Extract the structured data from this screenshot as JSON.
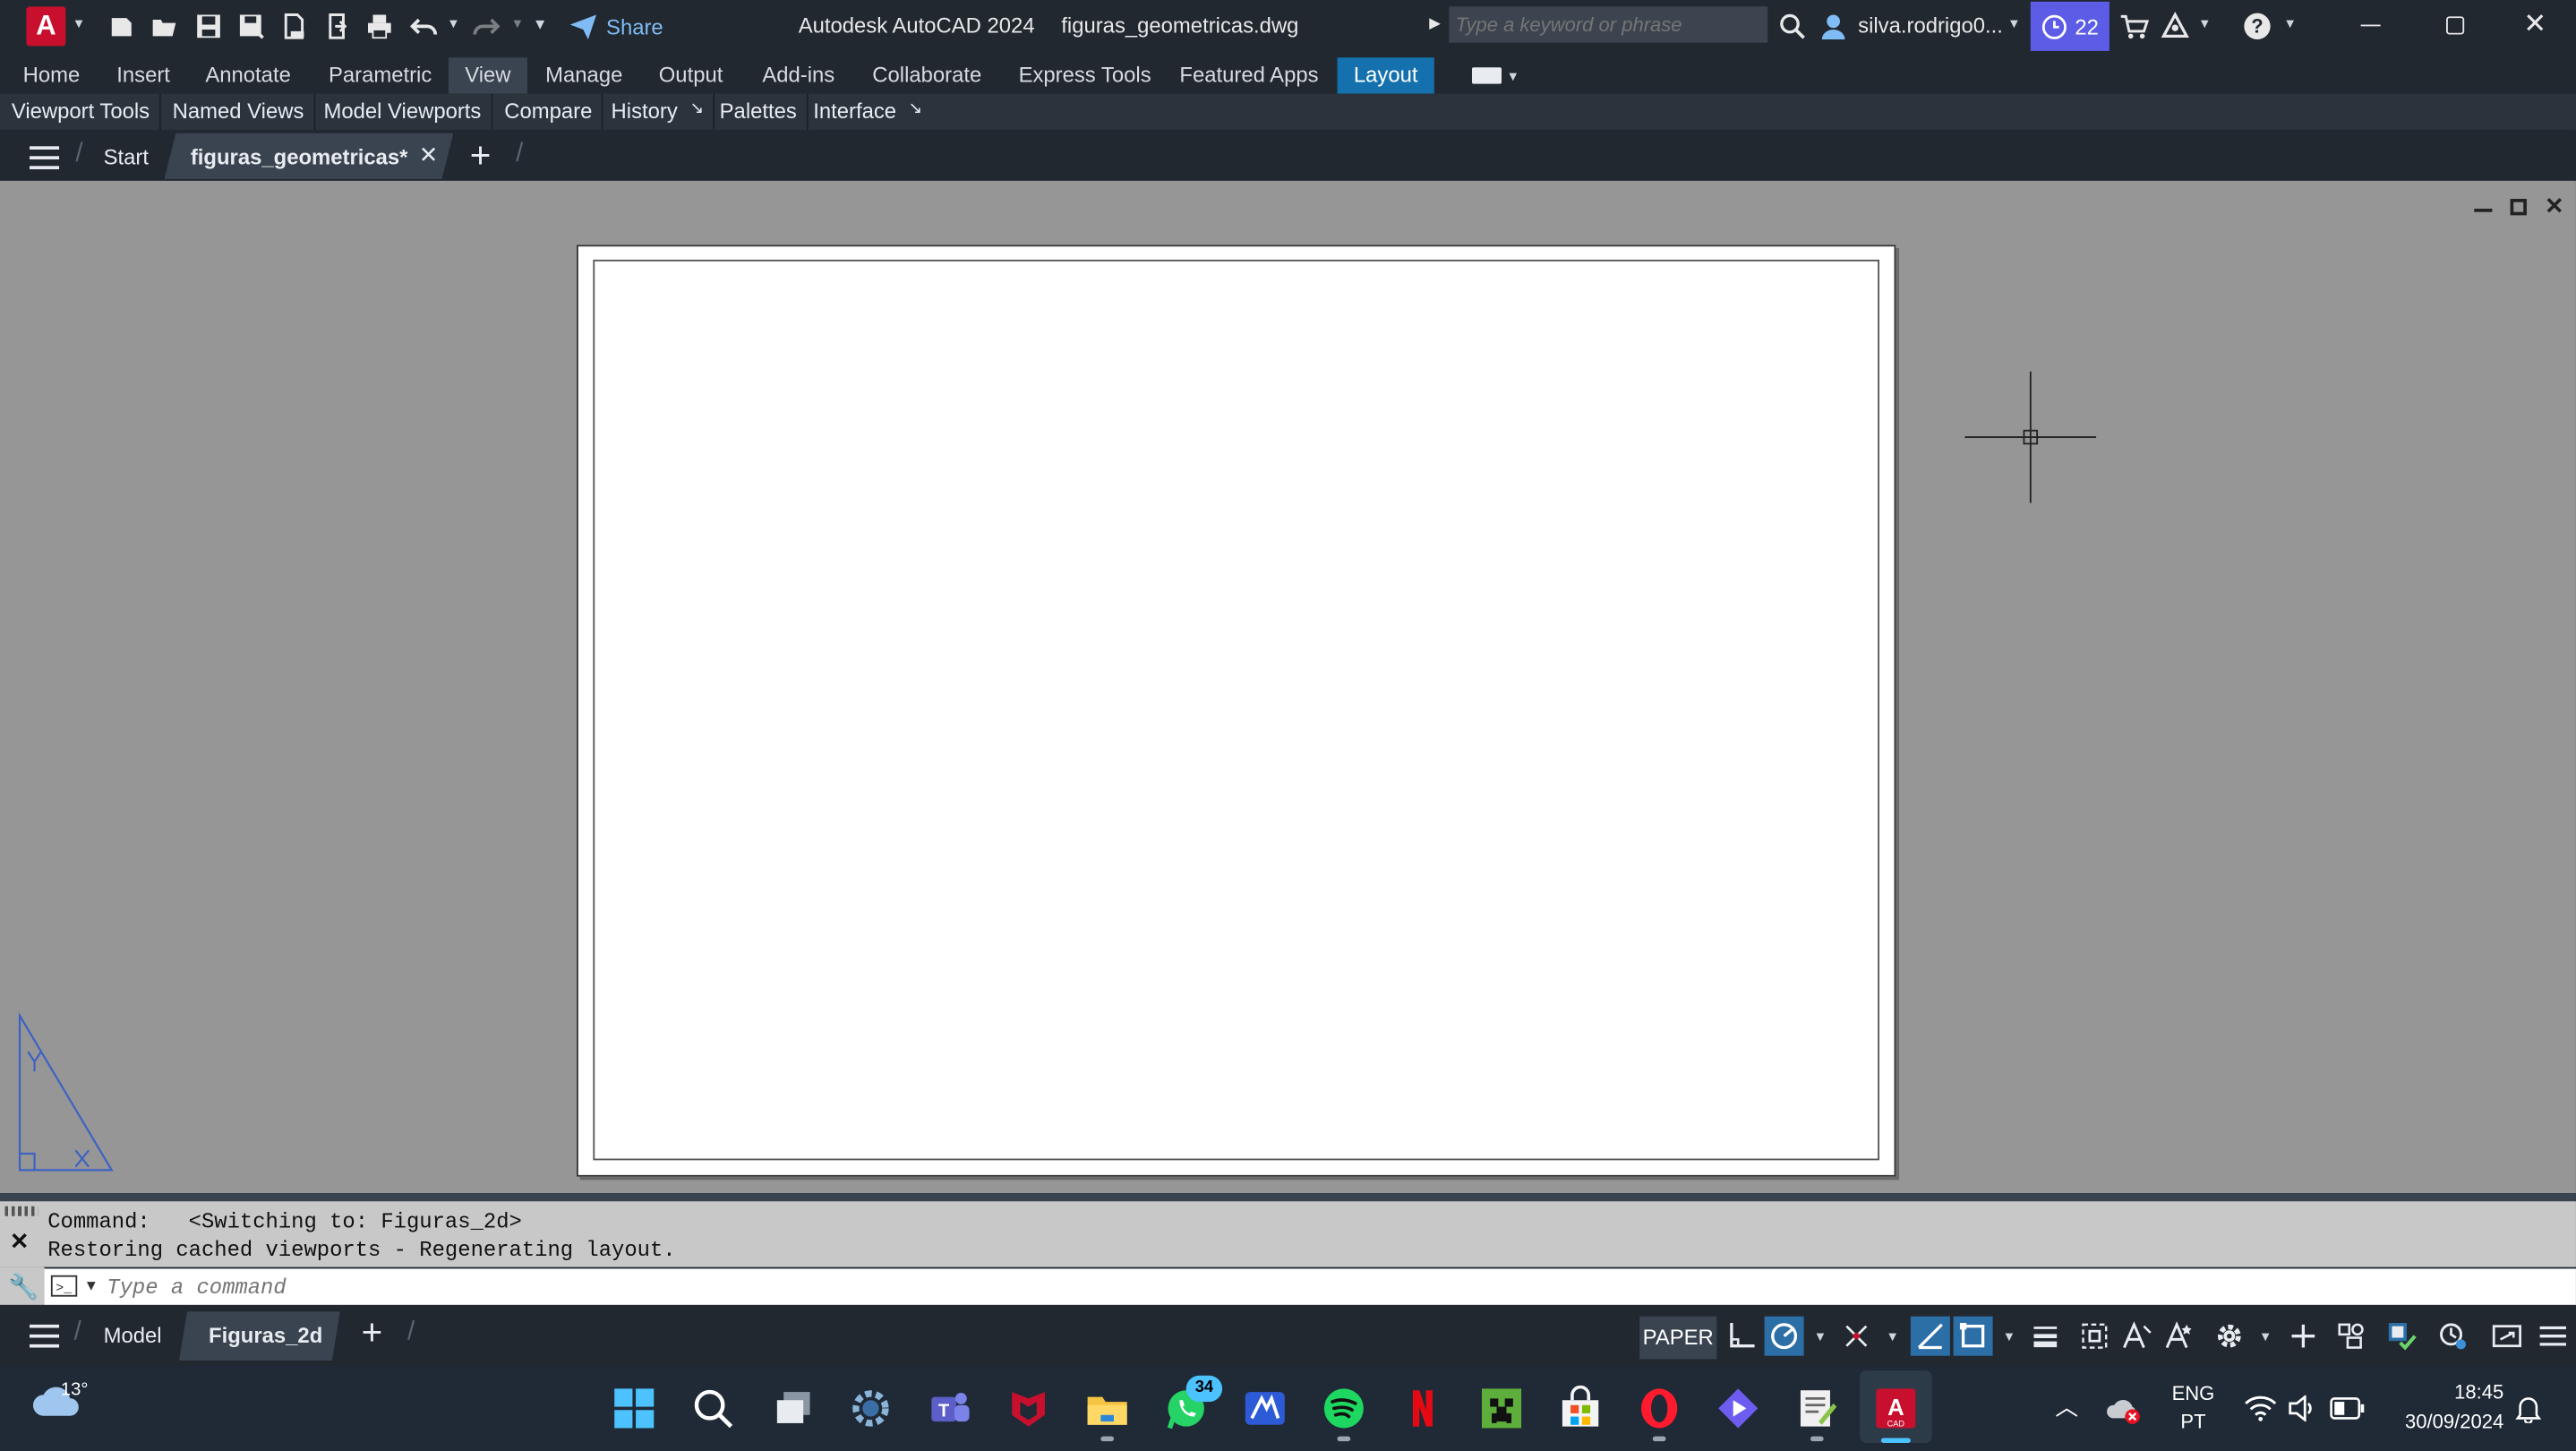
{
  "titlebar": {
    "app_name": "Autodesk AutoCAD 2024",
    "file_name": "figuras_geometricas.dwg",
    "share_label": "Share",
    "search_placeholder": "Type a keyword or phrase",
    "user_name": "silva.rodrigo0...",
    "notifications_count": "22",
    "app_icon_letter": "A",
    "accent_color": "#c8102e",
    "notif_color": "#5c5ce6"
  },
  "ribbon_tabs": [
    "Home",
    "Insert",
    "Annotate",
    "Parametric",
    "View",
    "Manage",
    "Output",
    "Add-ins",
    "Collaborate",
    "Express Tools",
    "Featured Apps",
    "Layout"
  ],
  "panels": [
    "Viewport Tools",
    "Named Views",
    "Model Viewports",
    "Compare",
    "History",
    "Palettes",
    "Interface"
  ],
  "doc_tabs": {
    "start": "Start",
    "active": "figuras_geometricas*"
  },
  "command": {
    "line1": "Command:   <Switching to: Figuras_2d>",
    "line2": "Restoring cached viewports - Regenerating layout.",
    "placeholder": "Type a command"
  },
  "layout_tabs": {
    "model": "Model",
    "active": "Figuras_2d"
  },
  "status": {
    "space": "PAPER"
  },
  "taskbar": {
    "temperature": "13°",
    "whatsapp_badge": "34",
    "lang_top": "ENG",
    "lang_bottom": "PT",
    "time": "18:45",
    "date": "30/09/2024"
  },
  "icons": [
    "autocad-icon",
    "new-icon",
    "open-icon",
    "save-icon",
    "save-as-icon",
    "plot-icon",
    "print-icon",
    "undo-icon",
    "redo-icon",
    "share-icon",
    "search-icon",
    "user-icon",
    "clock-icon",
    "cart-icon",
    "help-icon",
    "minimize-icon",
    "restore-icon",
    "close-icon",
    "hamburger-icon",
    "plus-icon",
    "crosshair-icon",
    "ucs-icon",
    "wrench-icon",
    "gear-icon",
    "windows-icon",
    "wifi-icon",
    "volume-icon",
    "battery-icon",
    "bell-icon"
  ]
}
